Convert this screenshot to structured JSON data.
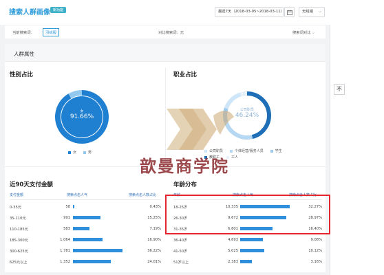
{
  "header": {
    "title": "搜索人群画像",
    "pill": "新功能",
    "date_range": "最近7天（2018-03-05~2018-03-11）",
    "terminal": "无线端"
  },
  "filter": {
    "current_label": "当前搜索词：",
    "current_term": "羽绒服",
    "compare_label": "对比搜索词：无",
    "compare_button": "搜索词对比"
  },
  "section": {
    "title": "人群属性"
  },
  "gender": {
    "title": "性别占比",
    "center_label": "女",
    "center_value": "91.66%",
    "legend": [
      {
        "label": "女",
        "color": "#1f7fd0"
      },
      {
        "label": "男",
        "color": "#93c8ef"
      }
    ],
    "chart_data": {
      "type": "pie",
      "categories": [
        "女",
        "男"
      ],
      "values": [
        91.66,
        8.34
      ],
      "colors": [
        "#1f7fd0",
        "#93c8ef"
      ]
    }
  },
  "occupation": {
    "title": "职业占比",
    "center_label": "公司职员",
    "center_value": "46.24%",
    "legend": [
      {
        "label": "公司职员",
        "color": "#cfe6f8"
      },
      {
        "label": "个体经营/服务人员",
        "color": "#b6d8f3"
      },
      {
        "label": "学生",
        "color": "#9ccbef"
      },
      {
        "label": "教职工",
        "color": "#1f6fb8"
      },
      {
        "label": "工人",
        "color": "#e6f1fb"
      }
    ],
    "chart_data": {
      "type": "pie",
      "categories": [
        "公司职员",
        "个体经营/服务人员",
        "学生",
        "教职工",
        "工人"
      ],
      "values": [
        46.24,
        24,
        10,
        15,
        4.76
      ],
      "colors": [
        "#1f6fb8",
        "#b6d8f3",
        "#9ccbef",
        "#cfe6f8",
        "#e6f1fb"
      ]
    }
  },
  "payment": {
    "title": "近90天支付金额",
    "headers": [
      "支付金额",
      "搜索点击人气",
      "搜索点击人数占比"
    ],
    "chart_data": {
      "type": "table",
      "rows": [
        {
          "label": "0-35元",
          "value": "58",
          "n": 58,
          "pct": "0.43%"
        },
        {
          "label": "35-110元",
          "value": "991",
          "n": 991,
          "pct": "15.25%"
        },
        {
          "label": "110-185元",
          "value": "583",
          "n": 583,
          "pct": "7.19%"
        },
        {
          "label": "185-300元",
          "value": "1,064",
          "n": 1064,
          "pct": "16.90%"
        },
        {
          "label": "300-625元",
          "value": "1,781",
          "n": 1781,
          "pct": "36.22%"
        },
        {
          "label": "625元以上",
          "value": "1,352",
          "n": 1352,
          "pct": "24.01%"
        }
      ]
    }
  },
  "age": {
    "title": "年龄分布",
    "headers": [
      "年龄",
      "搜索点击人气",
      "搜索点击人数占比"
    ],
    "chart_data": {
      "type": "table",
      "rows": [
        {
          "label": "18-25岁",
          "value": "10,335",
          "n": 10335,
          "pct": "32.27%"
        },
        {
          "label": "26-30岁",
          "value": "9,672",
          "n": 9672,
          "pct": "28.97%"
        },
        {
          "label": "31-35岁",
          "value": "6,801",
          "n": 6801,
          "pct": "16.40%"
        },
        {
          "label": "36-40岁",
          "value": "4,693",
          "n": 4693,
          "pct": "9.08%"
        },
        {
          "label": "41-50岁",
          "value": "5,025",
          "n": 5025,
          "pct": "10.12%"
        },
        {
          "label": "51岁以上",
          "value": "2,383",
          "n": 2383,
          "pct": "3.16%"
        }
      ]
    }
  },
  "watermark_text": "歆曼商学院",
  "side": {
    "button_label": "不"
  }
}
